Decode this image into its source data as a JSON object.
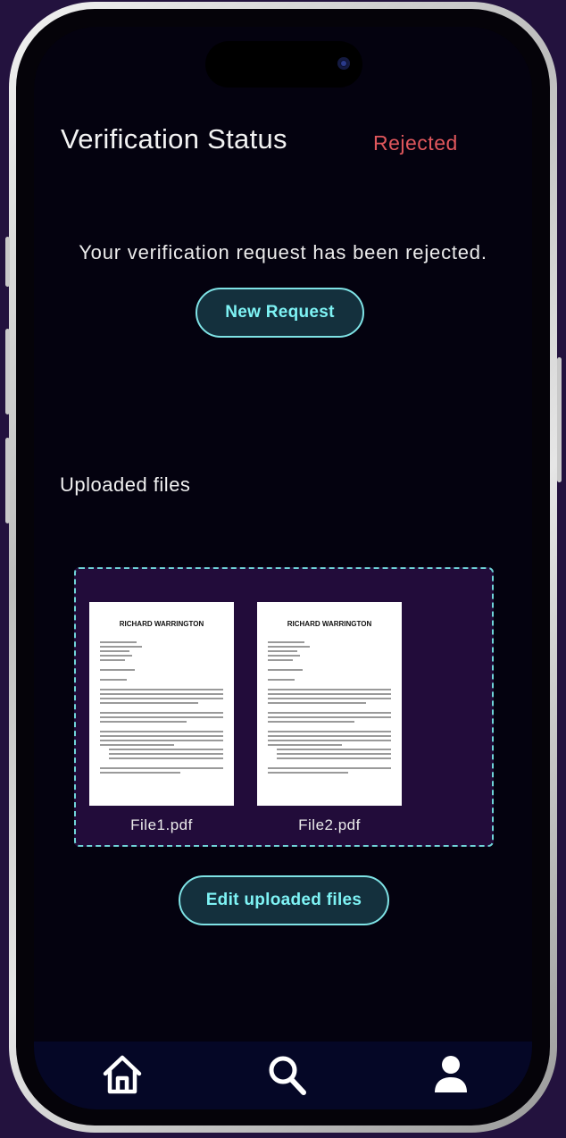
{
  "header": {
    "title": "Verification Status",
    "status": "Rejected",
    "status_color": "#e0575c"
  },
  "message": "Your verification request has been rejected.",
  "actions": {
    "new_request_label": "New Request",
    "edit_files_label": "Edit uploaded files"
  },
  "uploads": {
    "section_label": "Uploaded files",
    "files": [
      {
        "name": "File1.pdf",
        "preview_heading": "RICHARD WARRINGTON"
      },
      {
        "name": "File2.pdf",
        "preview_heading": "RICHARD WARRINGTON"
      }
    ]
  },
  "nav": {
    "items": [
      {
        "icon": "home-icon"
      },
      {
        "icon": "search-icon"
      },
      {
        "icon": "profile-icon"
      }
    ]
  },
  "colors": {
    "accent": "#7ef3f5",
    "background": "#04020f",
    "files_panel": "#220c3a"
  }
}
